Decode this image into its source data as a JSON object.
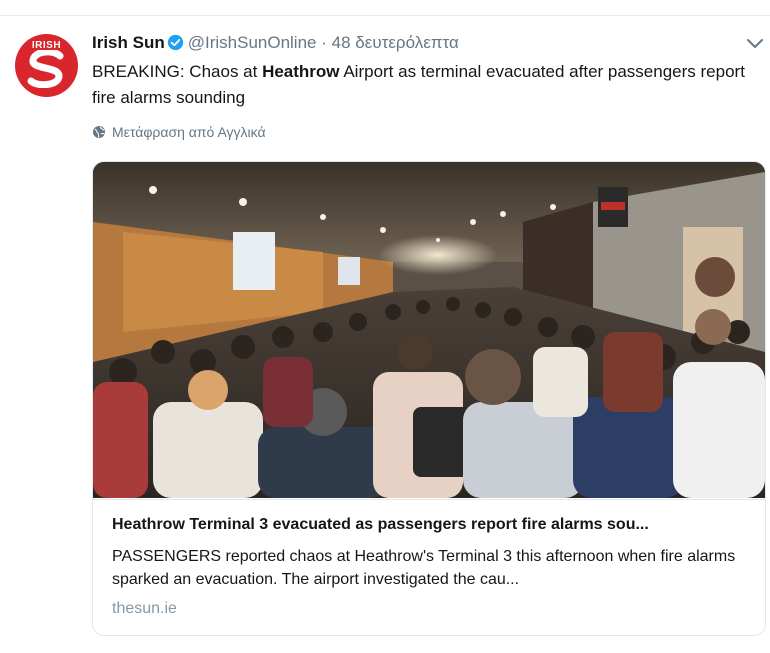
{
  "tweet": {
    "author_name": "Irish Sun",
    "handle": "@IrishSunOnline",
    "separator": "·",
    "timestamp": "48 δευτερόλεπτα",
    "text_prefix": "BREAKING: Chaos at ",
    "text_bold": "Heathrow",
    "text_suffix": " Airport as terminal evacuated after passengers report fire alarms sounding",
    "translate_label": "Μετάφραση από Αγγλικά"
  },
  "avatar": {
    "logo_text": "IRISH",
    "logo_letter": "S",
    "brand_color": "#d8262c"
  },
  "card": {
    "title": "Heathrow Terminal 3 evacuated as passengers report fire alarms sou...",
    "description": "PASSENGERS reported chaos at Heathrow's Terminal 3 this afternoon when fire alarms sparked an evacuation. The airport investigated the cau...",
    "domain": "thesun.ie"
  },
  "icons": {
    "verified": "verified-badge-icon",
    "caret": "chevron-down-icon",
    "globe": "globe-icon"
  },
  "colors": {
    "verified_blue": "#1da1f2",
    "muted": "#657786"
  }
}
